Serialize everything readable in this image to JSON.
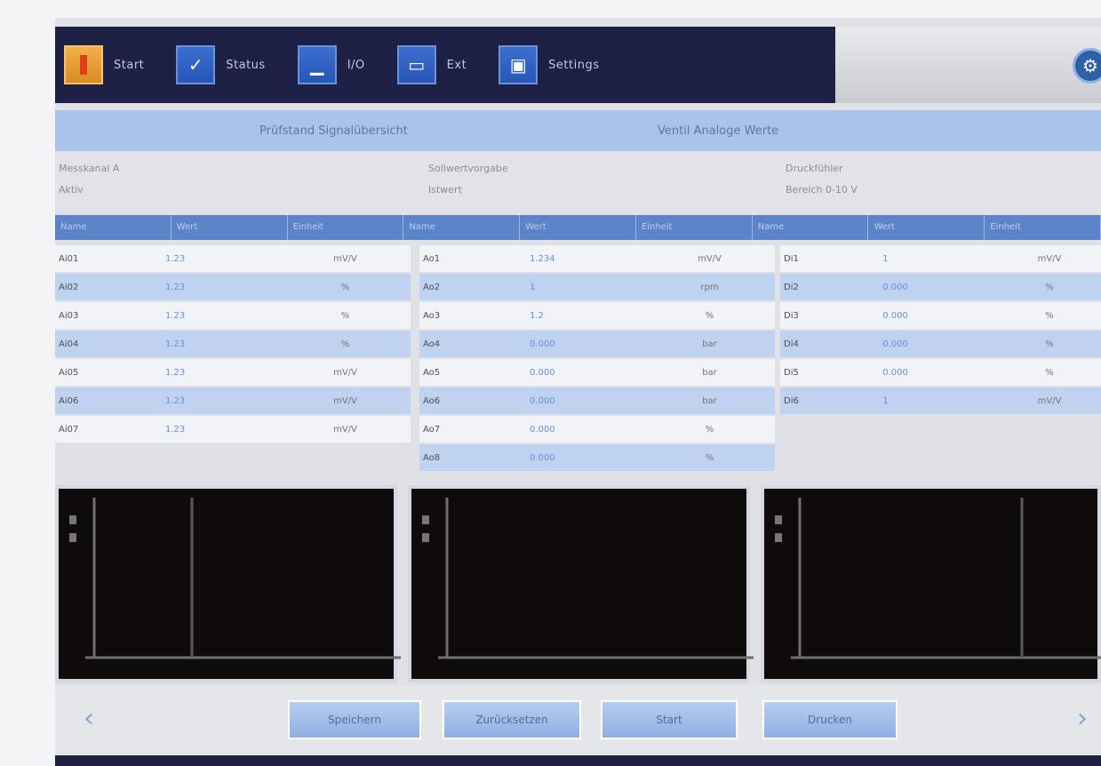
{
  "toolbar": {
    "items": [
      {
        "label": "Start",
        "icon": "home-icon"
      },
      {
        "label": "Status",
        "icon": "check-icon"
      },
      {
        "label": "I/O",
        "icon": "io-icon"
      },
      {
        "label": "Ext",
        "icon": "ext-icon"
      },
      {
        "label": "Settings",
        "icon": "settings-icon"
      }
    ]
  },
  "title_band": {
    "left": "Prüfstand Signalübersicht",
    "right": "Ventil Analoge Werte"
  },
  "info": {
    "c1_line1": "Messkanal A",
    "c1_line2": "Aktiv",
    "c2_line1": "Sollwertvorgabe",
    "c2_line2": "Istwert",
    "c3_line1": "Druckfühler",
    "c3_line2": "Bereich 0-10 V"
  },
  "headers": [
    "Name",
    "Wert",
    "Einheit",
    "Name",
    "Wert",
    "Einheit",
    "Name",
    "Wert",
    "Einheit"
  ],
  "columns": [
    {
      "rows": [
        {
          "name": "Ai01",
          "value": "1.23",
          "unit": "mV/V"
        },
        {
          "name": "Ai02",
          "value": "1.23",
          "unit": "%"
        },
        {
          "name": "Ai03",
          "value": "1.23",
          "unit": "%"
        },
        {
          "name": "Ai04",
          "value": "1.23",
          "unit": "%"
        },
        {
          "name": "Ai05",
          "value": "1.23",
          "unit": "mV/V"
        },
        {
          "name": "Ai06",
          "value": "1.23",
          "unit": "mV/V"
        },
        {
          "name": "Ai07",
          "value": "1.23",
          "unit": "mV/V"
        }
      ]
    },
    {
      "rows": [
        {
          "name": "Ao1",
          "value": "1.234",
          "unit": "mV/V"
        },
        {
          "name": "Ao2",
          "value": "1",
          "unit": "rpm"
        },
        {
          "name": "Ao3",
          "value": "1.2",
          "unit": "%"
        },
        {
          "name": "Ao4",
          "value": "0.000",
          "unit": "bar"
        },
        {
          "name": "Ao5",
          "value": "0.000",
          "unit": "bar"
        },
        {
          "name": "Ao6",
          "value": "0.000",
          "unit": "bar"
        },
        {
          "name": "Ao7",
          "value": "0.000",
          "unit": "%"
        },
        {
          "name": "Ao8",
          "value": "0.000",
          "unit": "%"
        }
      ]
    },
    {
      "rows": [
        {
          "name": "Di1",
          "value": "1",
          "unit": "mV/V"
        },
        {
          "name": "Di2",
          "value": "0.000",
          "unit": "%"
        },
        {
          "name": "Di3",
          "value": "0.000",
          "unit": "%"
        },
        {
          "name": "Di4",
          "value": "0.000",
          "unit": "%"
        },
        {
          "name": "Di5",
          "value": "0.000",
          "unit": "%"
        },
        {
          "name": "Di6",
          "value": "1",
          "unit": "mV/V"
        }
      ]
    }
  ],
  "bottom": {
    "buttons": [
      "Speichern",
      "Zurücksetzen",
      "Start",
      "Drucken"
    ],
    "prev": "‹",
    "next": "›"
  },
  "colors": {
    "toolbar_bg": "#1e2045",
    "accent_blue": "#5c84c8",
    "row_alt": "#bfd3f0",
    "home_orange": "#f2b048"
  }
}
